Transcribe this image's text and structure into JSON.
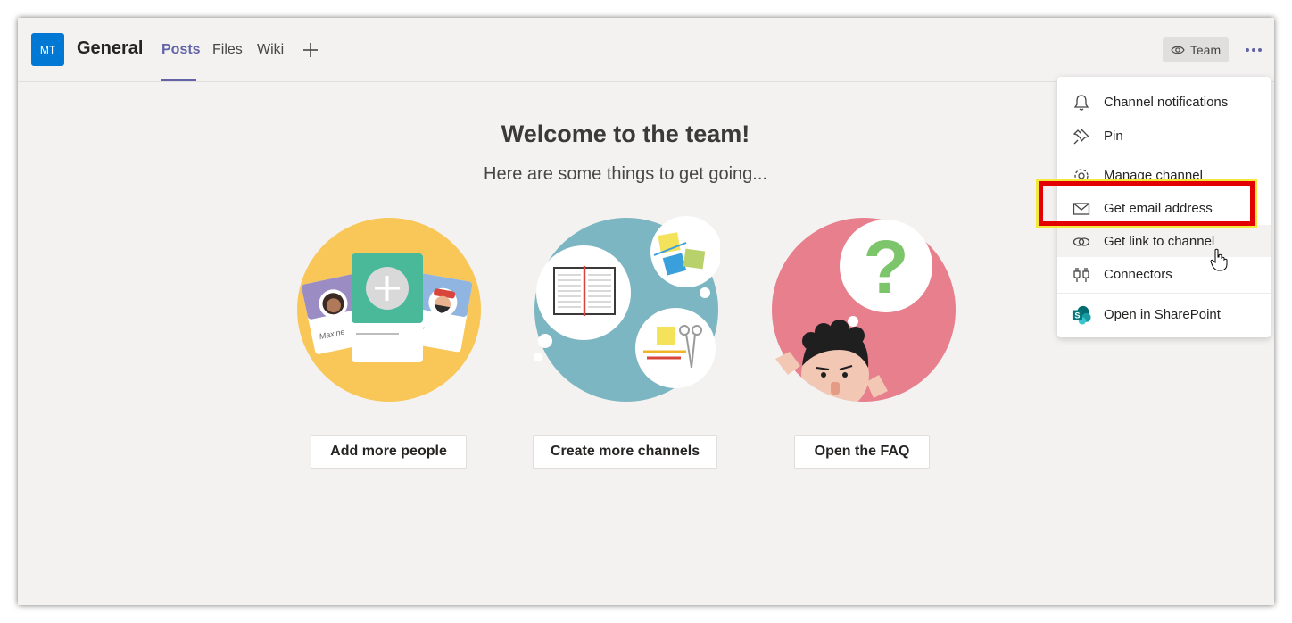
{
  "header": {
    "avatar_initials": "MT",
    "channel_title": "General",
    "tabs": [
      {
        "label": "Posts",
        "active": true
      },
      {
        "label": "Files",
        "active": false
      },
      {
        "label": "Wiki",
        "active": false
      }
    ],
    "add_tab_icon": "plus-icon",
    "team_button_label": "Team",
    "more_icon": "ellipsis-icon"
  },
  "welcome": {
    "title": "Welcome to the team!",
    "subtitle": "Here are some things to get going...",
    "cards": [
      {
        "button_label": "Add more people",
        "card_names": [
          "Maxine",
          "ky"
        ]
      },
      {
        "button_label": "Create more channels"
      },
      {
        "button_label": "Open the FAQ",
        "symbol": "?"
      }
    ]
  },
  "menu": {
    "items": [
      {
        "label": "Channel notifications",
        "icon": "bell-icon"
      },
      {
        "label": "Pin",
        "icon": "pin-icon"
      },
      {
        "label": "Manage channel",
        "icon": "gear-icon"
      },
      {
        "label": "Get email address",
        "icon": "mail-icon"
      },
      {
        "label": "Get link to channel",
        "icon": "link-icon"
      },
      {
        "label": "Connectors",
        "icon": "connectors-icon"
      },
      {
        "label": "Open in SharePoint",
        "icon": "sharepoint-icon"
      }
    ]
  },
  "colors": {
    "accent": "#6264a7",
    "avatar": "#0078d4",
    "highlight_border": "#e30000",
    "highlight_glow": "#f4e93a",
    "people_circle": "#f8c757",
    "channels_circle": "#7cb6c2",
    "faq_circle": "#e77f8d"
  }
}
